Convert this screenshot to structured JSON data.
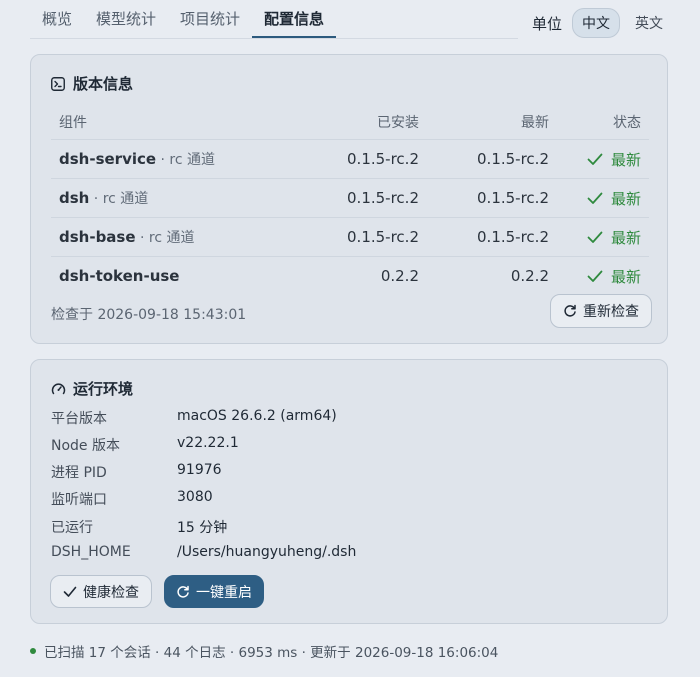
{
  "nav": {
    "tabs": [
      {
        "label": "概览"
      },
      {
        "label": "模型统计"
      },
      {
        "label": "项目统计"
      },
      {
        "label": "配置信息"
      }
    ],
    "active_tab": "配置信息",
    "unit_label": "单位",
    "units": [
      "中文",
      "英文"
    ],
    "active_unit": "中文"
  },
  "version_card": {
    "title": "版本信息",
    "headers": {
      "component": "组件",
      "installed": "已安装",
      "latest": "最新",
      "status": "状态"
    },
    "rows": [
      {
        "name": "dsh-service",
        "channel": " · rc 通道",
        "installed": "0.1.5-rc.2",
        "latest": "0.1.5-rc.2",
        "status": "最新"
      },
      {
        "name": "dsh",
        "channel": " · rc 通道",
        "installed": "0.1.5-rc.2",
        "latest": "0.1.5-rc.2",
        "status": "最新"
      },
      {
        "name": "dsh-base",
        "channel": " · rc 通道",
        "installed": "0.1.5-rc.2",
        "latest": "0.1.5-rc.2",
        "status": "最新"
      },
      {
        "name": "dsh-token-use",
        "channel": "",
        "installed": "0.2.2",
        "latest": "0.2.2",
        "status": "最新"
      }
    ],
    "checked_at": "检查于 2026-09-18 15:43:01",
    "recheck_label": "重新检查",
    "status_color": "#2f8a3e"
  },
  "env_card": {
    "title": "运行环境",
    "items": [
      {
        "key": "平台版本",
        "value": "macOS 26.6.2 (arm64)"
      },
      {
        "key": "Node 版本",
        "value": "v22.22.1"
      },
      {
        "key": "进程 PID",
        "value": "91976"
      },
      {
        "key": "监听端口",
        "value": "3080"
      },
      {
        "key": "已运行",
        "value": "15 分钟"
      },
      {
        "key": "DSH_HOME",
        "value": "/Users/huangyuheng/.dsh"
      }
    ],
    "health_label": "健康检查",
    "restart_label": "一键重启",
    "primary_color": "#2e5e84"
  },
  "footer": {
    "text": "已扫描 17 个会话 · 44 个日志 · 6953 ms · 更新于 2026-09-18 16:06:04"
  }
}
